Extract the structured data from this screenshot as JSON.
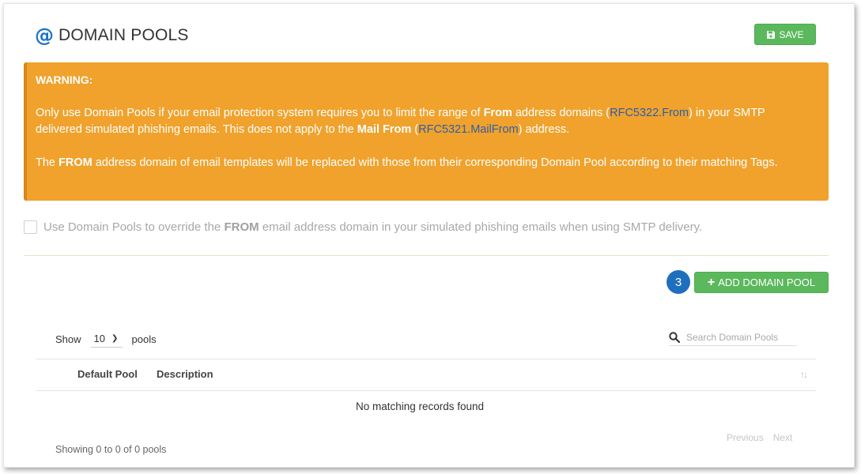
{
  "header": {
    "icon": "at-icon",
    "title": "DOMAIN POOLS",
    "save_label": "SAVE",
    "accent_color": "#1a73c8",
    "button_color": "#5cb85c"
  },
  "warning": {
    "title": "WARNING:",
    "p1_a": "Only use Domain Pools if your email protection system requires you to limit the range of ",
    "p1_from": "From",
    "p1_b": " address domains (",
    "p1_rfc1": "RFC5322.From",
    "p1_c": ") in your SMTP delivered simulated phishing emails. This does not apply to the ",
    "p1_mailfrom": "Mail From",
    "p1_d": " (",
    "p1_rfc2": "RFC5321.MailFrom",
    "p1_e": ") address.",
    "p2_a": "The ",
    "p2_from": "FROM",
    "p2_b": " address domain of email templates will be replaced with those from their corresponding Domain Pool according to their matching Tags.",
    "background_color": "#f0a22c"
  },
  "override": {
    "label_a": "Use Domain Pools to override the ",
    "label_bold": "FROM",
    "label_b": " email address domain in your simulated phishing emails when using SMTP delivery.",
    "checked": false
  },
  "actions": {
    "step_number": "3",
    "add_label": "ADD DOMAIN POOL"
  },
  "table": {
    "show_label": "Show",
    "page_length": "10",
    "pools_label": "pools",
    "search_placeholder": "Search Domain Pools",
    "columns": [
      "Default Pool",
      "Description"
    ],
    "empty_message": "No matching records found",
    "info": "Showing 0 to 0 of 0 pools",
    "prev_label": "Previous",
    "next_label": "Next"
  }
}
